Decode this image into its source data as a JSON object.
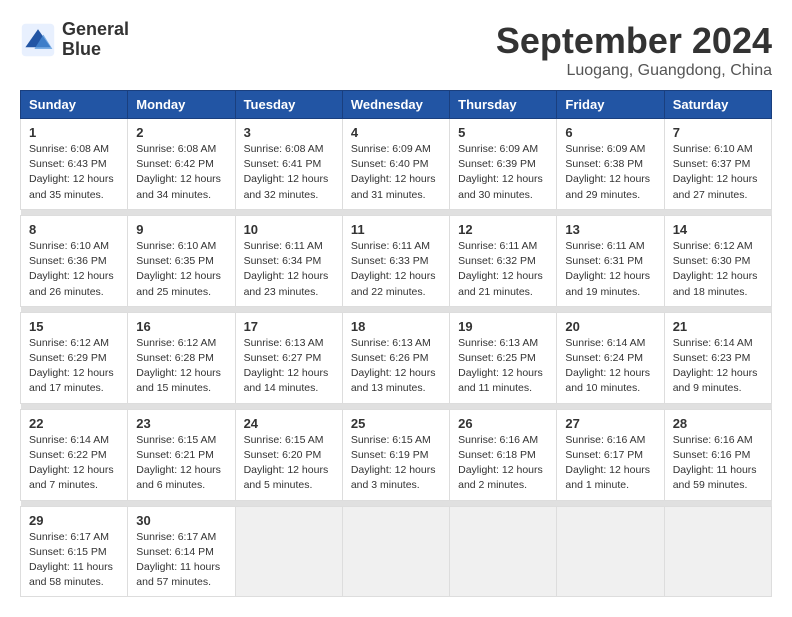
{
  "logo": {
    "line1": "General",
    "line2": "Blue"
  },
  "title": "September 2024",
  "subtitle": "Luogang, Guangdong, China",
  "days_header": [
    "Sunday",
    "Monday",
    "Tuesday",
    "Wednesday",
    "Thursday",
    "Friday",
    "Saturday"
  ],
  "weeks": [
    [
      {
        "num": "1",
        "sunrise": "Sunrise: 6:08 AM",
        "sunset": "Sunset: 6:43 PM",
        "daylight": "Daylight: 12 hours and 35 minutes."
      },
      {
        "num": "2",
        "sunrise": "Sunrise: 6:08 AM",
        "sunset": "Sunset: 6:42 PM",
        "daylight": "Daylight: 12 hours and 34 minutes."
      },
      {
        "num": "3",
        "sunrise": "Sunrise: 6:08 AM",
        "sunset": "Sunset: 6:41 PM",
        "daylight": "Daylight: 12 hours and 32 minutes."
      },
      {
        "num": "4",
        "sunrise": "Sunrise: 6:09 AM",
        "sunset": "Sunset: 6:40 PM",
        "daylight": "Daylight: 12 hours and 31 minutes."
      },
      {
        "num": "5",
        "sunrise": "Sunrise: 6:09 AM",
        "sunset": "Sunset: 6:39 PM",
        "daylight": "Daylight: 12 hours and 30 minutes."
      },
      {
        "num": "6",
        "sunrise": "Sunrise: 6:09 AM",
        "sunset": "Sunset: 6:38 PM",
        "daylight": "Daylight: 12 hours and 29 minutes."
      },
      {
        "num": "7",
        "sunrise": "Sunrise: 6:10 AM",
        "sunset": "Sunset: 6:37 PM",
        "daylight": "Daylight: 12 hours and 27 minutes."
      }
    ],
    [
      {
        "num": "8",
        "sunrise": "Sunrise: 6:10 AM",
        "sunset": "Sunset: 6:36 PM",
        "daylight": "Daylight: 12 hours and 26 minutes."
      },
      {
        "num": "9",
        "sunrise": "Sunrise: 6:10 AM",
        "sunset": "Sunset: 6:35 PM",
        "daylight": "Daylight: 12 hours and 25 minutes."
      },
      {
        "num": "10",
        "sunrise": "Sunrise: 6:11 AM",
        "sunset": "Sunset: 6:34 PM",
        "daylight": "Daylight: 12 hours and 23 minutes."
      },
      {
        "num": "11",
        "sunrise": "Sunrise: 6:11 AM",
        "sunset": "Sunset: 6:33 PM",
        "daylight": "Daylight: 12 hours and 22 minutes."
      },
      {
        "num": "12",
        "sunrise": "Sunrise: 6:11 AM",
        "sunset": "Sunset: 6:32 PM",
        "daylight": "Daylight: 12 hours and 21 minutes."
      },
      {
        "num": "13",
        "sunrise": "Sunrise: 6:11 AM",
        "sunset": "Sunset: 6:31 PM",
        "daylight": "Daylight: 12 hours and 19 minutes."
      },
      {
        "num": "14",
        "sunrise": "Sunrise: 6:12 AM",
        "sunset": "Sunset: 6:30 PM",
        "daylight": "Daylight: 12 hours and 18 minutes."
      }
    ],
    [
      {
        "num": "15",
        "sunrise": "Sunrise: 6:12 AM",
        "sunset": "Sunset: 6:29 PM",
        "daylight": "Daylight: 12 hours and 17 minutes."
      },
      {
        "num": "16",
        "sunrise": "Sunrise: 6:12 AM",
        "sunset": "Sunset: 6:28 PM",
        "daylight": "Daylight: 12 hours and 15 minutes."
      },
      {
        "num": "17",
        "sunrise": "Sunrise: 6:13 AM",
        "sunset": "Sunset: 6:27 PM",
        "daylight": "Daylight: 12 hours and 14 minutes."
      },
      {
        "num": "18",
        "sunrise": "Sunrise: 6:13 AM",
        "sunset": "Sunset: 6:26 PM",
        "daylight": "Daylight: 12 hours and 13 minutes."
      },
      {
        "num": "19",
        "sunrise": "Sunrise: 6:13 AM",
        "sunset": "Sunset: 6:25 PM",
        "daylight": "Daylight: 12 hours and 11 minutes."
      },
      {
        "num": "20",
        "sunrise": "Sunrise: 6:14 AM",
        "sunset": "Sunset: 6:24 PM",
        "daylight": "Daylight: 12 hours and 10 minutes."
      },
      {
        "num": "21",
        "sunrise": "Sunrise: 6:14 AM",
        "sunset": "Sunset: 6:23 PM",
        "daylight": "Daylight: 12 hours and 9 minutes."
      }
    ],
    [
      {
        "num": "22",
        "sunrise": "Sunrise: 6:14 AM",
        "sunset": "Sunset: 6:22 PM",
        "daylight": "Daylight: 12 hours and 7 minutes."
      },
      {
        "num": "23",
        "sunrise": "Sunrise: 6:15 AM",
        "sunset": "Sunset: 6:21 PM",
        "daylight": "Daylight: 12 hours and 6 minutes."
      },
      {
        "num": "24",
        "sunrise": "Sunrise: 6:15 AM",
        "sunset": "Sunset: 6:20 PM",
        "daylight": "Daylight: 12 hours and 5 minutes."
      },
      {
        "num": "25",
        "sunrise": "Sunrise: 6:15 AM",
        "sunset": "Sunset: 6:19 PM",
        "daylight": "Daylight: 12 hours and 3 minutes."
      },
      {
        "num": "26",
        "sunrise": "Sunrise: 6:16 AM",
        "sunset": "Sunset: 6:18 PM",
        "daylight": "Daylight: 12 hours and 2 minutes."
      },
      {
        "num": "27",
        "sunrise": "Sunrise: 6:16 AM",
        "sunset": "Sunset: 6:17 PM",
        "daylight": "Daylight: 12 hours and 1 minute."
      },
      {
        "num": "28",
        "sunrise": "Sunrise: 6:16 AM",
        "sunset": "Sunset: 6:16 PM",
        "daylight": "Daylight: 11 hours and 59 minutes."
      }
    ],
    [
      {
        "num": "29",
        "sunrise": "Sunrise: 6:17 AM",
        "sunset": "Sunset: 6:15 PM",
        "daylight": "Daylight: 11 hours and 58 minutes."
      },
      {
        "num": "30",
        "sunrise": "Sunrise: 6:17 AM",
        "sunset": "Sunset: 6:14 PM",
        "daylight": "Daylight: 11 hours and 57 minutes."
      },
      null,
      null,
      null,
      null,
      null
    ]
  ]
}
